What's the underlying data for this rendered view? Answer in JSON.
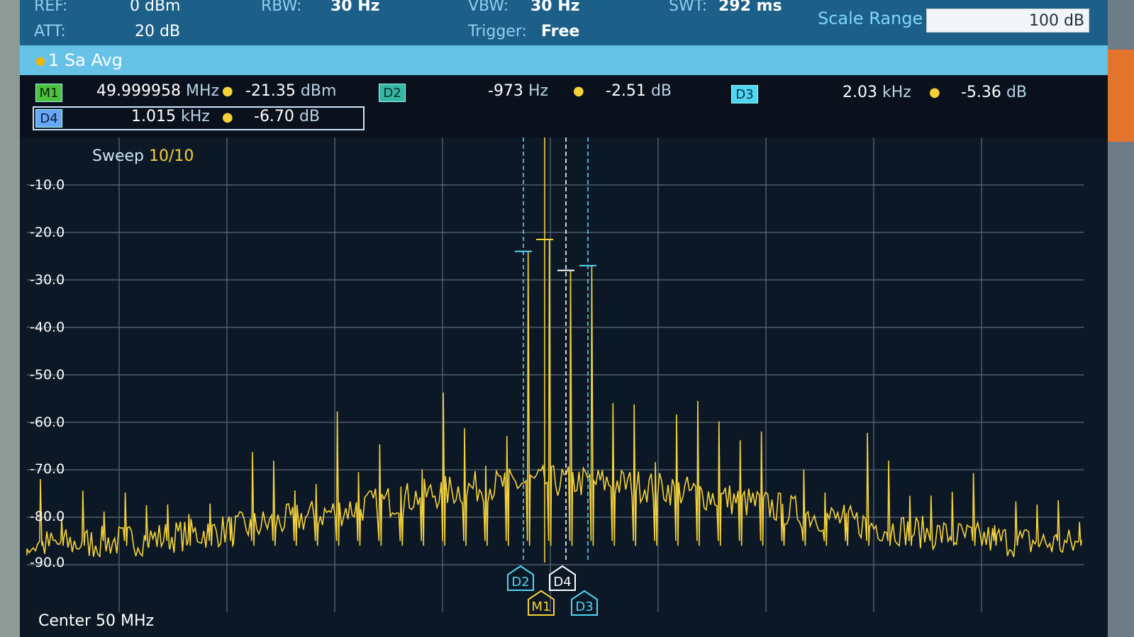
{
  "params": {
    "ref_label": "REF:",
    "ref_value": "0 dBm",
    "att_label": "ATT:",
    "att_value": "20 dB",
    "rbw_label": "RBW:",
    "rbw_value": "30 Hz",
    "vbw_label": "VBW:",
    "vbw_value": "30 Hz",
    "trigger_label": "Trigger:",
    "trigger_value": "Free",
    "swt_label": "SWT:",
    "swt_value": "292 ms",
    "scale_range_label": "Scale Range",
    "scale_range_value": "100 dB"
  },
  "trace": {
    "label": "1 Sa  Avg"
  },
  "markers": [
    {
      "id": "M1",
      "x_value": "49.999958",
      "x_unit": "MHz",
      "y_value": "-21.35",
      "y_unit": "dBm"
    },
    {
      "id": "D2",
      "x_value": "-973",
      "x_unit": "Hz",
      "y_value": "-2.51",
      "y_unit": "dB"
    },
    {
      "id": "D3",
      "x_value": "2.03",
      "x_unit": "kHz",
      "y_value": "-5.36",
      "y_unit": "dB"
    },
    {
      "id": "D4",
      "x_value": "1.015",
      "x_unit": "kHz",
      "y_value": "-6.70",
      "y_unit": "dB"
    }
  ],
  "plot": {
    "sweep_label": "Sweep",
    "sweep_value": "10/10",
    "center_label": "Center 50 MHz",
    "trace_color": "#f5d23a",
    "grid_color": "#5c6b7a",
    "y_ticks": [
      "-10.0",
      "-20.0",
      "-30.0",
      "-40.0",
      "-50.0",
      "-60.0",
      "-70.0",
      "-80.0",
      "-90.0"
    ],
    "flags": [
      {
        "label": "D2",
        "color": "#4fd6f2"
      },
      {
        "label": "D4",
        "color": "#ffffff"
      },
      {
        "label": "M1",
        "color": "#f5d23a"
      },
      {
        "label": "D3",
        "color": "#4fd6f2"
      }
    ]
  }
}
